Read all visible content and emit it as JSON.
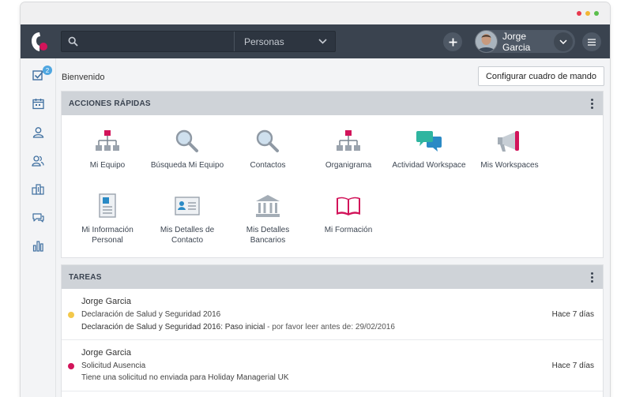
{
  "colors": {
    "topbar": "#3a434f",
    "brand_pink": "#d2145a",
    "accent_blue": "#4fa6e0",
    "task_yellow": "#f3c84b",
    "task_red": "#d2145a",
    "window_dot_red": "#e8394e",
    "window_dot_yellow": "#f2b634",
    "window_dot_green": "#5bbf4c"
  },
  "topbar": {
    "search_placeholder": "",
    "search_scope": "Personas",
    "user_name": "Jorge Garcia"
  },
  "sidebar": {
    "tasks_badge": "2",
    "items": [
      {
        "icon": "checkbox-icon"
      },
      {
        "icon": "calendar-icon"
      },
      {
        "icon": "person-icon"
      },
      {
        "icon": "team-icon"
      },
      {
        "icon": "building-icon"
      },
      {
        "icon": "chat-icon"
      },
      {
        "icon": "bar-chart-icon"
      }
    ]
  },
  "main": {
    "welcome": "Bienvenido",
    "config_button": "Configurar cuadro de mando"
  },
  "quick_actions": {
    "title": "ACCIONES RÁPIDAS",
    "items": [
      {
        "label": "Mi Equipo",
        "icon": "org-chart-icon"
      },
      {
        "label": "Búsqueda Mi Equipo",
        "icon": "magnifier-icon"
      },
      {
        "label": "Contactos",
        "icon": "magnifier-icon"
      },
      {
        "label": "Organigrama",
        "icon": "org-chart-icon"
      },
      {
        "label": "Actividad Workspace",
        "icon": "speech-bubbles-icon"
      },
      {
        "label": "Mis Workspaces",
        "icon": "megaphone-icon"
      },
      {
        "label": "Mi Información Personal",
        "icon": "document-icon"
      },
      {
        "label": "Mis Detalles de Contacto",
        "icon": "contact-card-icon"
      },
      {
        "label": "Mis Detalles Bancarios",
        "icon": "bank-icon"
      },
      {
        "label": "Mi Formación",
        "icon": "book-icon"
      }
    ]
  },
  "tasks": {
    "title": "TAREAS",
    "items": [
      {
        "user": "Jorge Garcia",
        "title": "Declaración de Salud y Seguridad 2016",
        "detail": "Declaración de Salud y Seguridad 2016: Paso inicial",
        "detail_note": " - por favor leer antes de: 29/02/2016",
        "time": "Hace 7 días",
        "status_color": "#f3c84b"
      },
      {
        "user": "Jorge Garcia",
        "title": "Solicitud Ausencia",
        "detail": "Tiene una solicitud no enviada para Holiday Managerial UK",
        "detail_note": "",
        "time": "Hace 7 días",
        "status_color": "#d2145a"
      }
    ]
  }
}
